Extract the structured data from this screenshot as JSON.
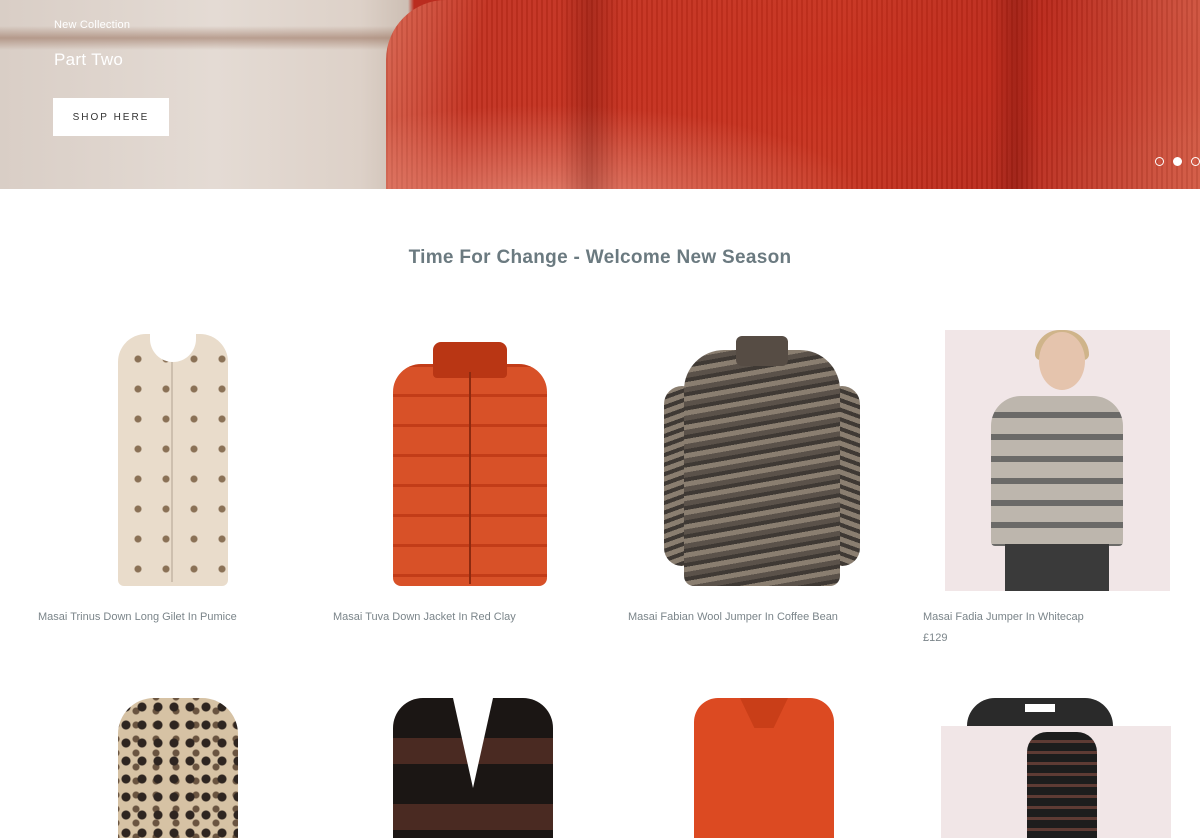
{
  "hero": {
    "eyebrow": "New Collection",
    "title": "Part Two",
    "cta_label": "SHOP HERE",
    "slides": 3,
    "active_slide": 2
  },
  "section": {
    "title": "Time For Change - Welcome New Season"
  },
  "products": [
    {
      "name": "Masai Trinus Down Long Gilet In Pumice",
      "price": ""
    },
    {
      "name": "Masai Tuva Down Jacket In Red Clay",
      "price": ""
    },
    {
      "name": "Masai Fabian Wool Jumper In Coffee Bean",
      "price": ""
    },
    {
      "name": "Masai Fadia Jumper In Whitecap",
      "price": "£129"
    }
  ],
  "colors": {
    "hero_red": "#c4301f",
    "text_muted": "#7b858a",
    "title": "#6b7a80"
  }
}
